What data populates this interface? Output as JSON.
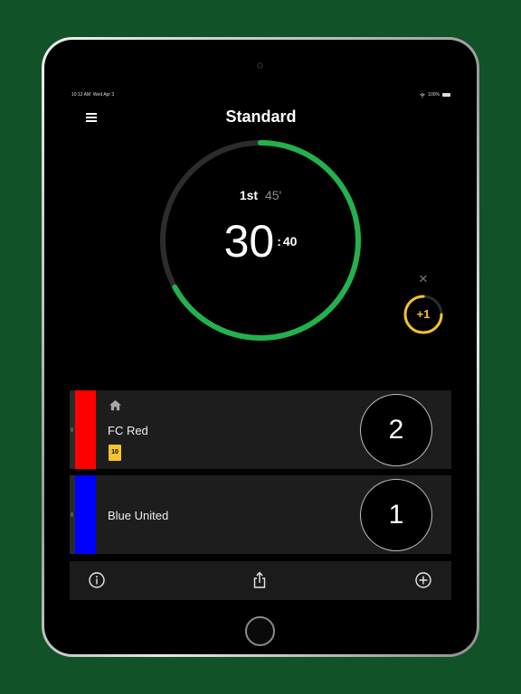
{
  "status_bar": {
    "time": "10:12 AM",
    "date": "Wed Apr 3",
    "battery": "100%"
  },
  "header": {
    "title": "Standard"
  },
  "timer": {
    "period": "1st",
    "period_length": "45'",
    "minutes": "30",
    "separator": ":",
    "seconds": "40",
    "progress_fraction": 0.67,
    "progress_color": "#23b14d",
    "track_color": "#2c2c2c"
  },
  "added_time": {
    "label": "+1",
    "color": "#f2c233",
    "progress_fraction": 0.75
  },
  "teams": [
    {
      "name": "FC Red",
      "color": "#ff0000",
      "score": "2",
      "is_home": true,
      "yellow_card_number": "10"
    },
    {
      "name": "Blue United",
      "color": "#0000ff",
      "score": "1",
      "is_home": false
    }
  ],
  "toolbar": {
    "icons": [
      "info-icon",
      "share-icon",
      "add-icon"
    ]
  },
  "colors": {
    "background": "#115228",
    "accent": "#23b14d",
    "card": "#f4c430"
  }
}
